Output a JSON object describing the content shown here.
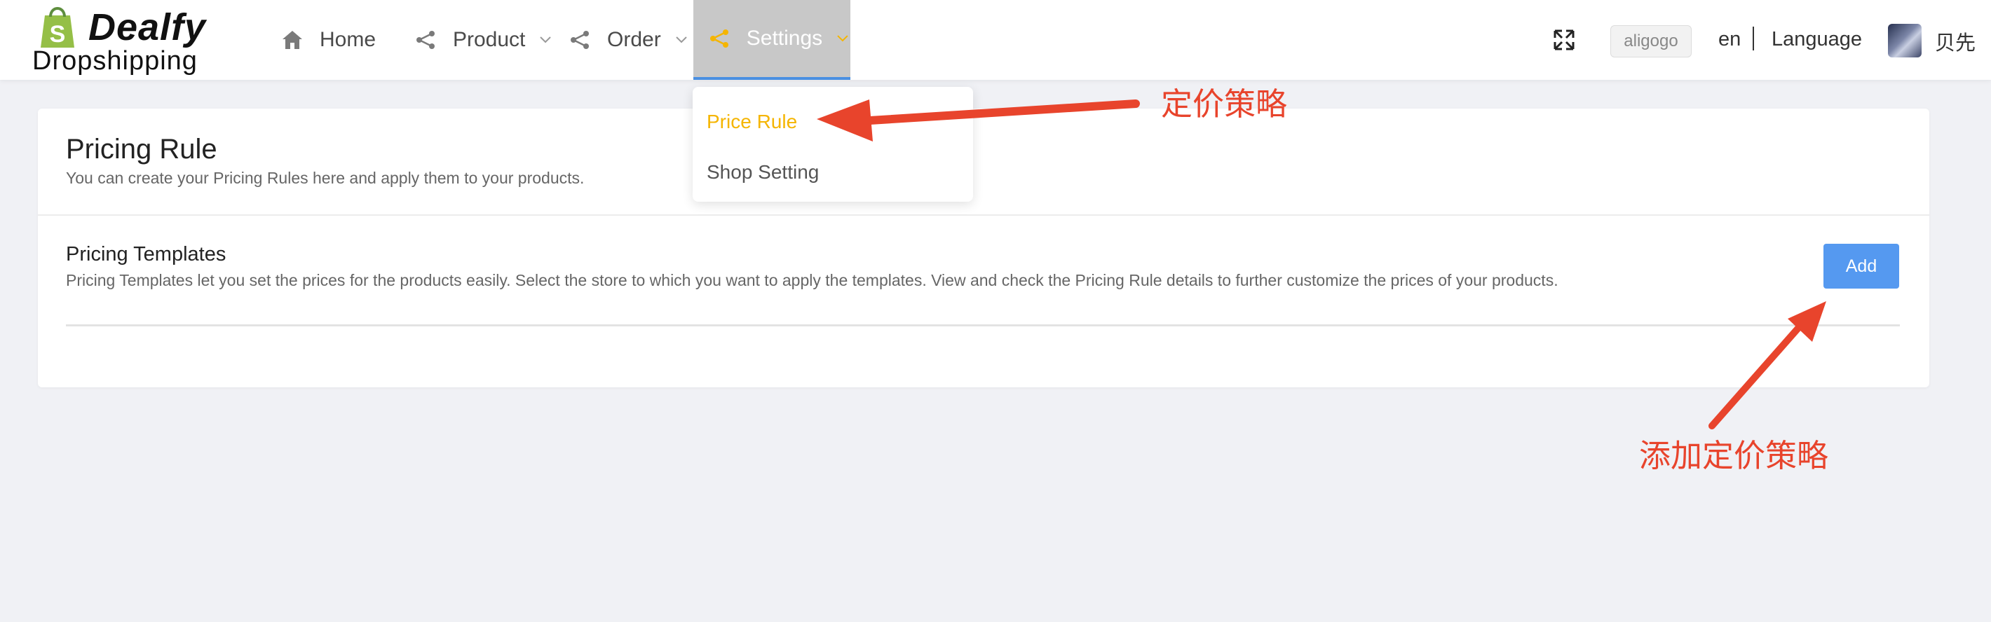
{
  "brand": {
    "name": "Dealfy",
    "subtitle": "Dropshipping"
  },
  "nav": {
    "items": [
      {
        "label": "Home",
        "icon": "home-icon"
      },
      {
        "label": "Product",
        "icon": "share-icon",
        "has_dropdown": true
      },
      {
        "label": "Order",
        "icon": "share-icon",
        "has_dropdown": true
      },
      {
        "label": "Settings",
        "icon": "share-icon",
        "has_dropdown": true,
        "active": true
      }
    ]
  },
  "header_right": {
    "fullscreen_icon": "fullscreen-icon",
    "store_tag": "aligogo",
    "lang_code": "en",
    "lang_label": "Language",
    "user_name": "贝先"
  },
  "settings_menu": {
    "items": [
      {
        "label": "Price Rule",
        "active": true
      },
      {
        "label": "Shop Setting"
      }
    ]
  },
  "page": {
    "title": "Pricing Rule",
    "description": "You can create your Pricing Rules here and apply them to your products.",
    "templates": {
      "title": "Pricing Templates",
      "description": "Pricing Templates let you set the prices for the products easily. Select the store to which you want to apply the templates. View and check the Pricing Rule details to further customize the prices of your products.",
      "add_label": "Add"
    }
  },
  "annotations": {
    "price_rule_note": "定价策略",
    "add_note": "添加定价策略"
  },
  "colors": {
    "accent_yellow": "#f5b500",
    "primary_blue": "#5599f0",
    "annotation_red": "#e8442c",
    "active_nav_bg": "#c8c8c8"
  }
}
